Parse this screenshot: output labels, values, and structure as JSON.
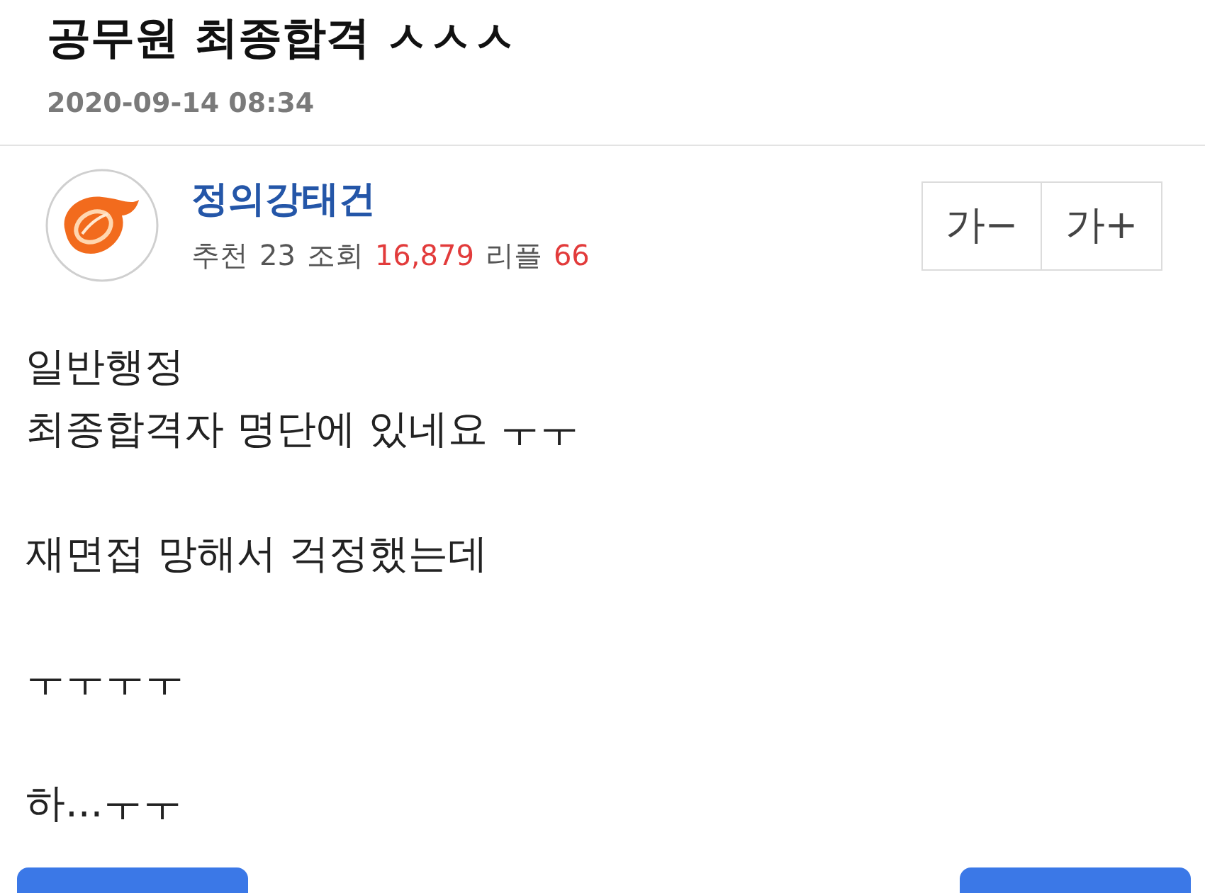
{
  "post": {
    "title": "공무원 최종합격 ㅅㅅㅅ",
    "date": "2020-09-14 08:34"
  },
  "author": {
    "name": "정의강태건",
    "stats": [
      {
        "label": "추천",
        "value": "23",
        "highlight": false
      },
      {
        "label": "조회",
        "value": "16,879",
        "highlight": true
      },
      {
        "label": "리플",
        "value": "66",
        "highlight": true
      }
    ]
  },
  "font_size_buttons": [
    {
      "label": "가−"
    },
    {
      "label": "가+"
    }
  ],
  "body": {
    "paragraphs": [
      [
        "일반행정",
        "최종합격자 명단에 있네요 ㅜㅜ"
      ],
      [
        "재면접 망해서 걱정했는데"
      ],
      [
        "ㅜㅜㅜㅜ"
      ],
      [
        "하...ㅜㅜ"
      ]
    ]
  }
}
